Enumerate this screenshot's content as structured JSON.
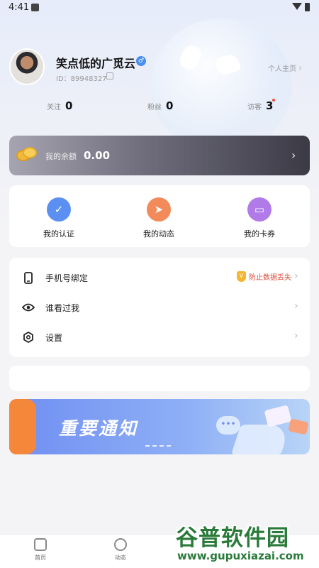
{
  "status_bar": {
    "time": "4:41"
  },
  "profile": {
    "username": "笑点低的广觅云",
    "gender_symbol": "♂",
    "uid": "ID：89948327",
    "homepage_link": "个人主页"
  },
  "stats": [
    {
      "label": "关注",
      "value": "0"
    },
    {
      "label": "粉丝",
      "value": "0"
    },
    {
      "label": "访客",
      "value": "3"
    }
  ],
  "balance": {
    "label": "我的余额",
    "value": "0.00"
  },
  "quick_actions": [
    {
      "label": "我的认证",
      "icon": "shield-check-icon",
      "color": "#5b8ff2"
    },
    {
      "label": "我的动态",
      "icon": "paper-plane-icon",
      "color": "#f38a5a"
    },
    {
      "label": "我的卡券",
      "icon": "ticket-icon",
      "color": "#b07be9"
    }
  ],
  "menu": {
    "items": [
      {
        "label": "手机号绑定",
        "icon": "phone-icon",
        "badge": "防止数据丢失"
      },
      {
        "label": "谁看过我",
        "icon": "eye-icon"
      },
      {
        "label": "设置",
        "icon": "settings-icon"
      }
    ]
  },
  "banner": {
    "title": "重要通知",
    "bubble": "•••"
  },
  "tabbar": {
    "items": [
      {
        "label": "首页",
        "icon": "home-icon"
      },
      {
        "label": "动态",
        "icon": "moments-icon"
      }
    ]
  },
  "watermark": {
    "title": "谷普软件园",
    "url": "www.gupuxiazai.com"
  },
  "colors": {
    "accent": "#4a8df0",
    "warning_text": "#e04a3a",
    "banner_orange": "#f5873b"
  }
}
